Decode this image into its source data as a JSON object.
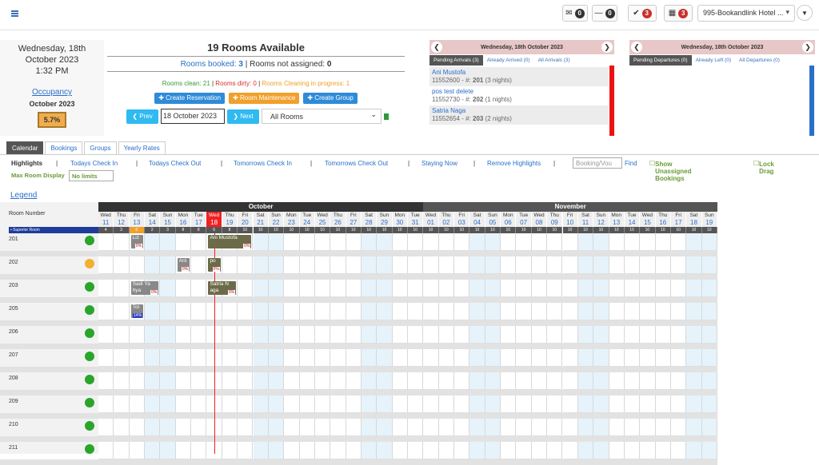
{
  "topbar": {
    "btn1": "0",
    "btn2": "0",
    "btn3": "3",
    "btn4": "3",
    "hotel": "995-Bookandlink Hotel ..."
  },
  "datebox": {
    "line1": "Wednesday, 18th",
    "line2": "October 2023",
    "line3": "1:32 PM",
    "occ": "Occupancy",
    "occ_month": "October 2023",
    "occ_val": "5.7%"
  },
  "summary": {
    "title": "19 Rooms Available",
    "booked_label": "Rooms booked: ",
    "booked": "3",
    "sep": " | Rooms not assigned: ",
    "not_assigned": "0",
    "clean": "Rooms clean: 21",
    "dirty": "Rooms dirty: 0",
    "cleaning": "Rooms Cleaning in progress: 1"
  },
  "buttons": {
    "create_res": "✚ Create Reservation",
    "room_maint": "✚ Room Maintenance",
    "create_group": "✚ Create Group",
    "prev": "❮ Prev",
    "next": "❯ Next",
    "date": "18 October 2023",
    "rooms": "All Rooms"
  },
  "arrivals": {
    "date": "Wednesday, 18th October 2023",
    "tabs": [
      "Pending Arrivals (3)",
      "Already Arrived (0)",
      "All Arrivals (3)"
    ],
    "items": [
      {
        "name": "Ani Mustofa",
        "id": "11552600 - #: ",
        "room": "201",
        "nights": " (3 nights)"
      },
      {
        "name": "pos test delete",
        "id": "11552730 - #: ",
        "room": "202",
        "nights": " (1 nights)"
      },
      {
        "name": "Satria Naga",
        "id": "11552654 - #: ",
        "room": "203",
        "nights": " (2 nights)"
      }
    ]
  },
  "departures": {
    "date": "Wednesday, 18th October 2023",
    "tabs": [
      "Pending Departures (0)",
      "Already Left (0)",
      "All Departures (0)"
    ]
  },
  "tabs": [
    "Calendar",
    "Bookings",
    "Groups",
    "Yearly Rates"
  ],
  "highlights": {
    "label": "Highlights",
    "items": [
      "Todays Check In",
      "Todays Check Out",
      "Tomorrows Check In",
      "Tomorrows Check Out",
      "Staying Now",
      "Remove Highlights"
    ],
    "search_ph": "Booking/Vou",
    "find": "Find",
    "show_unassigned": "Show Unassigned Bookings",
    "lock_drag": "Lock Drag",
    "max_room": "Max Room Display",
    "max_val": "No limits"
  },
  "legend": "Legend",
  "calendar": {
    "room_number": "Room Number",
    "superior": "Superior Room",
    "months": [
      "October",
      "November"
    ],
    "days": [
      [
        "Wed",
        "11"
      ],
      [
        "Thu",
        "12"
      ],
      [
        "Fri",
        "13"
      ],
      [
        "Sat",
        "14"
      ],
      [
        "Sun",
        "15"
      ],
      [
        "Mon",
        "16"
      ],
      [
        "Tue",
        "17"
      ],
      [
        "Wed",
        "18"
      ],
      [
        "Thu",
        "19"
      ],
      [
        "Fri",
        "20"
      ],
      [
        "Sat",
        "21"
      ],
      [
        "Sun",
        "22"
      ],
      [
        "Mon",
        "23"
      ],
      [
        "Tue",
        "24"
      ],
      [
        "Wed",
        "25"
      ],
      [
        "Thu",
        "26"
      ],
      [
        "Fri",
        "27"
      ],
      [
        "Sat",
        "28"
      ],
      [
        "Sun",
        "29"
      ],
      [
        "Mon",
        "30"
      ],
      [
        "Tue",
        "31"
      ],
      [
        "Wed",
        "01"
      ],
      [
        "Thu",
        "02"
      ],
      [
        "Fri",
        "03"
      ],
      [
        "Sat",
        "04"
      ],
      [
        "Sun",
        "05"
      ],
      [
        "Mon",
        "06"
      ],
      [
        "Tue",
        "07"
      ],
      [
        "Wed",
        "08"
      ],
      [
        "Thu",
        "09"
      ],
      [
        "Fri",
        "10"
      ],
      [
        "Sat",
        "11"
      ],
      [
        "Sun",
        "12"
      ],
      [
        "Mon",
        "13"
      ],
      [
        "Tue",
        "14"
      ],
      [
        "Wed",
        "15"
      ],
      [
        "Thu",
        "16"
      ],
      [
        "Fri",
        "17"
      ],
      [
        "Sat",
        "18"
      ],
      [
        "Sun",
        "19"
      ]
    ],
    "avail": [
      "4",
      "3",
      "0",
      "2",
      "3",
      "8",
      "8",
      "6",
      "8",
      "10",
      "10",
      "10",
      "10",
      "10",
      "10",
      "10",
      "10",
      "10",
      "10",
      "10",
      "10",
      "10",
      "10",
      "10",
      "10",
      "10",
      "10",
      "10",
      "10",
      "10",
      "10",
      "10",
      "10",
      "10",
      "10",
      "10",
      "10",
      "10",
      "10",
      "10"
    ],
    "rooms": [
      {
        "n": "201",
        "c": "#2aa52a"
      },
      {
        "n": "202",
        "c": "#f0b030"
      },
      {
        "n": "203",
        "c": "#2aa52a"
      },
      {
        "n": "205",
        "c": "#2aa52a"
      },
      {
        "n": "206",
        "c": "#2aa52a"
      },
      {
        "n": "207",
        "c": "#2aa52a"
      },
      {
        "n": "208",
        "c": "#2aa52a"
      },
      {
        "n": "209",
        "c": "#2aa52a"
      },
      {
        "n": "210",
        "c": "#2aa52a"
      },
      {
        "n": "211",
        "c": "#2aa52a"
      }
    ],
    "bookings": [
      {
        "row": 0,
        "start": 2,
        "len": 1,
        "t": "Liz",
        "p": "0%",
        "c": "#888"
      },
      {
        "row": 0,
        "start": 7,
        "len": 3,
        "t": "Ani Mustofa",
        "p": "0%",
        "c": "#6b6b4a"
      },
      {
        "row": 1,
        "start": 5,
        "len": 1,
        "t": "Ani",
        "p": "0%",
        "c": "#888"
      },
      {
        "row": 1,
        "start": 7,
        "len": 1,
        "t": "po",
        "p": "0%",
        "c": "#6b6b4a"
      },
      {
        "row": 2,
        "start": 2,
        "len": 2,
        "t": "Sadi Ya\nhya",
        "p": "0%",
        "c": "#888"
      },
      {
        "row": 2,
        "start": 7,
        "len": 2,
        "t": "Satria N\naga",
        "p": "0%",
        "c": "#6b6b4a"
      },
      {
        "row": 3,
        "start": 2,
        "len": 1,
        "t": "Tol",
        "p": "14%",
        "c": "#888"
      }
    ]
  }
}
